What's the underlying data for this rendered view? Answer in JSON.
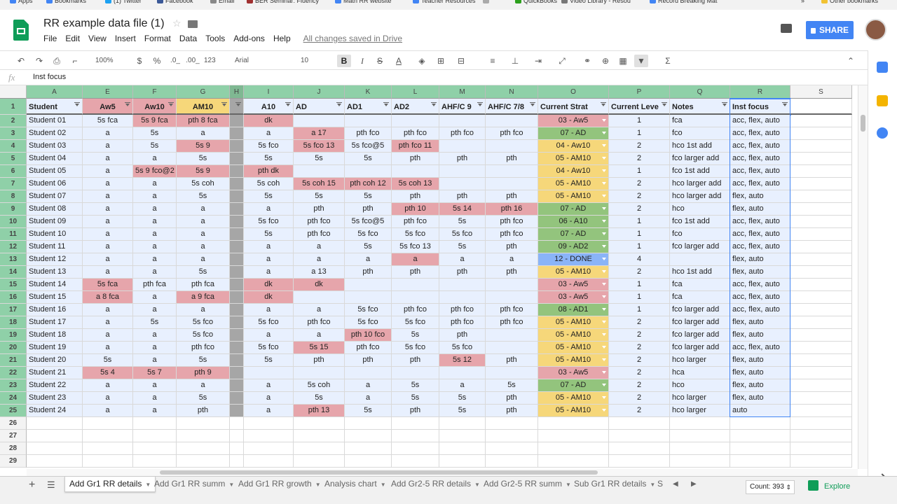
{
  "bookmarks": [
    {
      "label": "Apps",
      "color": "#4285f4"
    },
    {
      "label": "Bookmarks",
      "color": "#4285f4"
    },
    {
      "label": "(1) Twitter",
      "color": "#1da1f2"
    },
    {
      "label": "Facebook",
      "color": "#3b5998"
    },
    {
      "label": "Email",
      "color": "#888888"
    },
    {
      "label": "BER Seminar: Fluency",
      "color": "#a03030"
    },
    {
      "label": "Math RR website",
      "color": "#4285f4"
    },
    {
      "label": "Teacher Resources",
      "color": "#4285f4"
    },
    {
      "label": "",
      "color": "#aaaaaa"
    },
    {
      "label": "QuickBooks",
      "color": "#2ca01c"
    },
    {
      "label": "Video Library - Resou",
      "color": "#777777"
    },
    {
      "label": "Record Breaking Mat",
      "color": "#4285f4"
    },
    {
      "label": "»",
      "color": ""
    },
    {
      "label": "Other bookmarks",
      "color": "#f1c232"
    }
  ],
  "doc": {
    "title": "RR example data file (1)",
    "saved": "All changes saved in Drive",
    "share": "SHARE"
  },
  "menu": [
    "File",
    "Edit",
    "View",
    "Insert",
    "Format",
    "Data",
    "Tools",
    "Add-ons",
    "Help"
  ],
  "toolbar": {
    "zoom": "100%",
    "currency": "$",
    "percent": "%",
    "dec_less": ".0_",
    "dec_more": ".00_",
    "format123": "123",
    "font": "Arial",
    "size": "10",
    "bold": "B",
    "italic": "I",
    "strike": "S",
    "textcolor": "A",
    "sigma": "Σ"
  },
  "formula": {
    "fx": "fx",
    "value": "Inst focus"
  },
  "colors": {
    "pink": "#e6a5ab",
    "green": "#93c47d",
    "yellow": "#f6d77a",
    "blue": "#8ab4f8",
    "grayH": "#a6a6a6",
    "header_green": "#8fd0a8",
    "cell_blue": "#e8f0fe"
  },
  "columns": [
    {
      "letter": "A",
      "header": "Student"
    },
    {
      "letter": "E",
      "header": "Aw5"
    },
    {
      "letter": "F",
      "header": "Aw10"
    },
    {
      "letter": "G",
      "header": "AM10"
    },
    {
      "letter": "H",
      "header": ""
    },
    {
      "letter": "I",
      "header": "A10"
    },
    {
      "letter": "J",
      "header": "AD"
    },
    {
      "letter": "K",
      "header": "AD1"
    },
    {
      "letter": "L",
      "header": "AD2"
    },
    {
      "letter": "M",
      "header": "AHF/C 9"
    },
    {
      "letter": "N",
      "header": "AHF/C 7/8"
    },
    {
      "letter": "O",
      "header": "Current Strat"
    },
    {
      "letter": "P",
      "header": "Current Leve"
    },
    {
      "letter": "Q",
      "header": "Notes"
    },
    {
      "letter": "R",
      "header": "Inst focus"
    },
    {
      "letter": "S",
      "header": ""
    }
  ],
  "rows": [
    {
      "num": "2",
      "cells": [
        "Student 01",
        "5s  fca",
        "5s 9  fca",
        "pth 8  fca",
        "",
        "dk",
        "",
        "",
        "",
        "",
        "",
        "03 - Aw5",
        "1",
        "fca",
        "acc, flex, auto"
      ]
    },
    {
      "num": "3",
      "cells": [
        "Student 02",
        "a",
        "5s",
        "a",
        "",
        "a",
        "a 17",
        "pth fco",
        "pth fco",
        "pth fco",
        "pth fco",
        "07 - AD",
        "1",
        "fco",
        "acc, flex, auto"
      ]
    },
    {
      "num": "4",
      "cells": [
        "Student 03",
        "a",
        "5s",
        "5s 9",
        "",
        "5s fco",
        "5s fco 13",
        "5s fco@5",
        "pth fco 11",
        "",
        "",
        "04 - Aw10",
        "2",
        "hco 1st add",
        "acc, flex, auto"
      ]
    },
    {
      "num": "5",
      "cells": [
        "Student 04",
        "a",
        "a",
        "5s",
        "",
        "5s",
        "5s",
        "5s",
        "pth",
        "pth",
        "pth",
        "05 - AM10",
        "2",
        "fco larger add",
        "acc, flex, auto"
      ]
    },
    {
      "num": "6",
      "cells": [
        "Student 05",
        "a",
        "5s 9 fco@2",
        "5s 9",
        "",
        "pth  dk",
        "",
        "",
        "",
        "",
        "",
        "04 - Aw10",
        "1",
        "fco 1st add",
        "acc, flex, auto"
      ]
    },
    {
      "num": "7",
      "cells": [
        "Student 06",
        "a",
        "a",
        "5s coh",
        "",
        "5s coh",
        "5s coh 15",
        "pth coh 12",
        "5s coh 13",
        "",
        "",
        "05 - AM10",
        "2",
        "hco larger add",
        "acc, flex, auto"
      ]
    },
    {
      "num": "8",
      "cells": [
        "Student 07",
        "a",
        "a",
        "5s",
        "",
        "5s",
        "5s",
        "5s",
        "pth",
        "pth",
        "pth",
        "05 - AM10",
        "2",
        "hco larger add",
        "flex, auto"
      ]
    },
    {
      "num": "9",
      "cells": [
        "Student 08",
        "a",
        "a",
        "a",
        "",
        "a",
        "pth",
        "pth",
        "pth 10",
        "5s 14",
        "pth 16",
        "07 - AD",
        "2",
        "hco",
        "flex, auto"
      ]
    },
    {
      "num": "10",
      "cells": [
        "Student 09",
        "a",
        "a",
        "a",
        "",
        "5s fco",
        "pth fco",
        "5s fco@5",
        "pth fco",
        "5s",
        "pth fco",
        "06 - A10",
        "1",
        "fco 1st add",
        "acc, flex, auto"
      ]
    },
    {
      "num": "11",
      "cells": [
        "Student 10",
        "a",
        "a",
        "a",
        "",
        "5s",
        "pth fco",
        "5s fco",
        "5s fco",
        "5s fco",
        "pth fco",
        "07 - AD",
        "1",
        "fco",
        "acc, flex, auto"
      ]
    },
    {
      "num": "12",
      "cells": [
        "Student 11",
        "a",
        "a",
        "a",
        "",
        "a",
        "a",
        "5s",
        "5s fco 13",
        "5s",
        "pth",
        "09 - AD2",
        "1",
        "fco larger add",
        "acc, flex, auto"
      ]
    },
    {
      "num": "13",
      "cells": [
        "Student 12",
        "a",
        "a",
        "a",
        "",
        "a",
        "a",
        "a",
        "a",
        "a",
        "a",
        "12 - DONE",
        "4",
        "",
        "flex, auto"
      ]
    },
    {
      "num": "14",
      "cells": [
        "Student 13",
        "a",
        "a",
        "5s",
        "",
        "a",
        "a 13",
        "pth",
        "pth",
        "pth",
        "pth",
        "05 - AM10",
        "2",
        "hco 1st add",
        "flex, auto"
      ]
    },
    {
      "num": "15",
      "cells": [
        "Student 14",
        "5s  fca",
        "pth fca",
        "pth  fca",
        "",
        "dk",
        "dk",
        "",
        "",
        "",
        "",
        "03 - Aw5",
        "1",
        "fca",
        "acc, flex, auto"
      ]
    },
    {
      "num": "16",
      "cells": [
        "Student 15",
        "a 8  fca",
        "a",
        "a 9  fca",
        "",
        "dk",
        "",
        "",
        "",
        "",
        "",
        "03 - Aw5",
        "1",
        "fca",
        "acc, flex, auto"
      ]
    },
    {
      "num": "17",
      "cells": [
        "Student 16",
        "a",
        "a",
        "a",
        "",
        "a",
        "a",
        "5s fco",
        "pth fco",
        "pth fco",
        "pth fco",
        "08 - AD1",
        "1",
        "fco larger add",
        "acc, flex, auto"
      ]
    },
    {
      "num": "18",
      "cells": [
        "Student 17",
        "a",
        "5s",
        "5s fco",
        "",
        "5s fco",
        "pth fco",
        "5s fco",
        "5s fco",
        "pth fco",
        "pth fco",
        "05 - AM10",
        "2",
        "fco larger add",
        "flex, auto"
      ]
    },
    {
      "num": "19",
      "cells": [
        "Student 18",
        "a",
        "a",
        "5s fco",
        "",
        "a",
        "a",
        "pth 10 fco",
        "5s",
        "pth",
        "",
        "05 - AM10",
        "2",
        "fco larger add",
        "flex, auto"
      ]
    },
    {
      "num": "20",
      "cells": [
        "Student 19",
        "a",
        "a",
        "pth fco",
        "",
        "5s fco",
        "5s 15",
        "pth fco",
        "5s fco",
        "5s fco",
        "",
        "05 - AM10",
        "2",
        "fco larger add",
        "acc, flex, auto"
      ]
    },
    {
      "num": "21",
      "cells": [
        "Student 20",
        "5s",
        "a",
        "5s",
        "",
        "5s",
        "pth",
        "pth",
        "pth",
        "5s 12",
        "pth",
        "05 - AM10",
        "2",
        "hco larger",
        "flex, auto"
      ]
    },
    {
      "num": "22",
      "cells": [
        "Student 21",
        "5s 4",
        "5s 7",
        "pth 9",
        "",
        "",
        "",
        "",
        "",
        "",
        "",
        "03 - Aw5",
        "2",
        "hca",
        "flex, auto"
      ]
    },
    {
      "num": "23",
      "cells": [
        "Student 22",
        "a",
        "a",
        "a",
        "",
        "a",
        "5s coh",
        "a",
        "5s",
        "a",
        "5s",
        "07 - AD",
        "2",
        "hco",
        "flex, auto"
      ]
    },
    {
      "num": "24",
      "cells": [
        "Student 23",
        "a",
        "a",
        "5s",
        "",
        "a",
        "5s",
        "a",
        "5s",
        "5s",
        "pth",
        "05 - AM10",
        "2",
        "hco larger",
        "flex, auto"
      ]
    },
    {
      "num": "25",
      "cells": [
        "Student 24",
        "a",
        "a",
        "pth",
        "",
        "a",
        "pth 13",
        "5s",
        "pth",
        "5s",
        "pth",
        "05 - AM10",
        "2",
        "hco larger",
        "auto"
      ]
    }
  ],
  "empty_rows": [
    "26",
    "27",
    "28",
    "29"
  ],
  "sheet_tabs": [
    "Add Gr1 RR details",
    "Add Gr1 RR summ",
    "Add Gr1 RR growth",
    "Analysis chart",
    "Add Gr2-5 RR details",
    "Add Gr2-5 RR summ",
    "Sub Gr1 RR details",
    "S"
  ],
  "status": {
    "count": "Count: 393",
    "explore": "Explore"
  }
}
